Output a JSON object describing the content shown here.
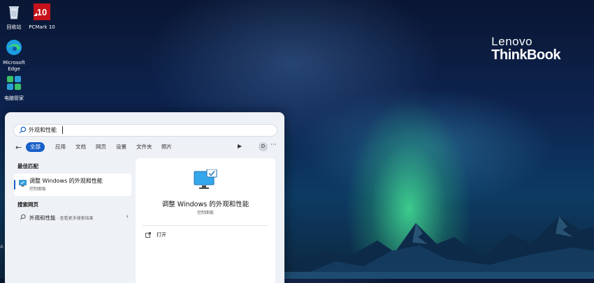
{
  "desktop": {
    "icons": [
      {
        "name": "recycle-bin",
        "label": "回收站"
      },
      {
        "name": "pcmark10",
        "label": "PCMark 10",
        "badge": "10"
      },
      {
        "name": "microsoft-edge",
        "label_line1": "Microsoft",
        "label_line2": "Edge"
      },
      {
        "name": "pc-manager",
        "label": "电脑管家"
      }
    ],
    "brand": {
      "line1": "Lenovo",
      "line2": "ThinkBook"
    },
    "edge_fragment": "A"
  },
  "search": {
    "query": "外观和性能"
  },
  "filters": {
    "items": [
      "全部",
      "应用",
      "文档",
      "网页",
      "设置",
      "文件夹",
      "照片"
    ],
    "active_index": 0,
    "avatar_initial": "D",
    "more": "···"
  },
  "results": {
    "best_match_header": "最佳匹配",
    "best_match": {
      "title": "调整 Windows 的外观和性能",
      "subtitle": "控制面板"
    },
    "web_header": "搜索网页",
    "web_item": {
      "title": "外观和性能",
      "subtitle": " - 查看更多搜索结果"
    }
  },
  "detail": {
    "title": "调整 Windows 的外观和性能",
    "subtitle": "控制面板",
    "action_open": "打开"
  },
  "colors": {
    "accent": "#1860c8",
    "panel_bg": "#eef1f6"
  }
}
